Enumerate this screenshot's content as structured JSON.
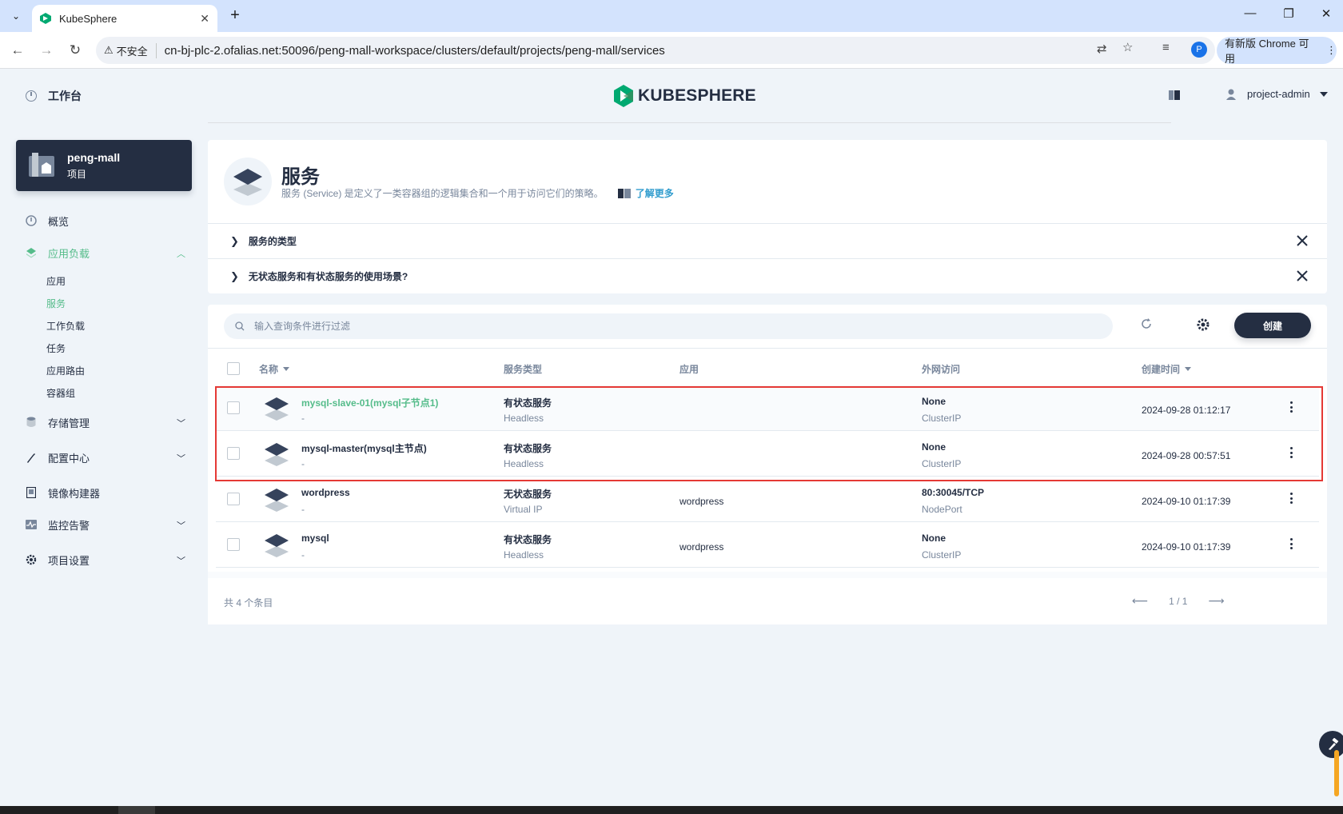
{
  "browser": {
    "tab_title": "KubeSphere",
    "insecure_label": "不安全",
    "url": "cn-bj-plc-2.ofalias.net:50096/peng-mall-workspace/clusters/default/projects/peng-mall/services",
    "profile_initial": "P",
    "update_label": "有新版 Chrome 可用"
  },
  "header": {
    "workbench": "工作台",
    "logo_text": "KUBESPHERE",
    "user": "project-admin"
  },
  "project": {
    "name": "peng-mall",
    "type": "项目"
  },
  "sidebar": {
    "overview": "概览",
    "app_workloads": "应用负载",
    "sub_items": [
      "应用",
      "服务",
      "工作负载",
      "任务",
      "应用路由",
      "容器组"
    ],
    "storage": "存储管理",
    "config": "配置中心",
    "image_builder": "镜像构建器",
    "monitoring": "监控告警",
    "project_settings": "项目设置"
  },
  "banner": {
    "title": "服务",
    "description": "服务 (Service) 是定义了一类容器组的逻辑集合和一个用于访问它们的策略。",
    "learn_more": "了解更多"
  },
  "faq": [
    "服务的类型",
    "无状态服务和有状态服务的使用场景?"
  ],
  "toolbar": {
    "search_placeholder": "输入查询条件进行过滤",
    "create": "创建"
  },
  "table": {
    "columns": [
      "名称",
      "服务类型",
      "应用",
      "外网访问",
      "创建时间"
    ],
    "rows": [
      {
        "name": "mysql-slave-01(mysql子节点1)",
        "desc": "-",
        "type": "有状态服务",
        "subtype": "Headless",
        "app": "",
        "access": "None",
        "access_type": "ClusterIP",
        "created": "2024-09-28 01:12:17"
      },
      {
        "name": "mysql-master(mysql主节点)",
        "desc": "-",
        "type": "有状态服务",
        "subtype": "Headless",
        "app": "",
        "access": "None",
        "access_type": "ClusterIP",
        "created": "2024-09-28 00:57:51"
      },
      {
        "name": "wordpress",
        "desc": "-",
        "type": "无状态服务",
        "subtype": "Virtual IP",
        "app": "wordpress",
        "access": "80:30045/TCP",
        "access_type": "NodePort",
        "created": "2024-09-10 01:17:39"
      },
      {
        "name": "mysql",
        "desc": "-",
        "type": "有状态服务",
        "subtype": "Headless",
        "app": "wordpress",
        "access": "None",
        "access_type": "ClusterIP",
        "created": "2024-09-10 01:17:39"
      }
    ],
    "total": "共 4 个条目",
    "page": "1 / 1"
  },
  "colors": {
    "accent": "#55bc8a",
    "dark": "#242e42",
    "highlight": "#e53935",
    "link": "#329dce"
  }
}
